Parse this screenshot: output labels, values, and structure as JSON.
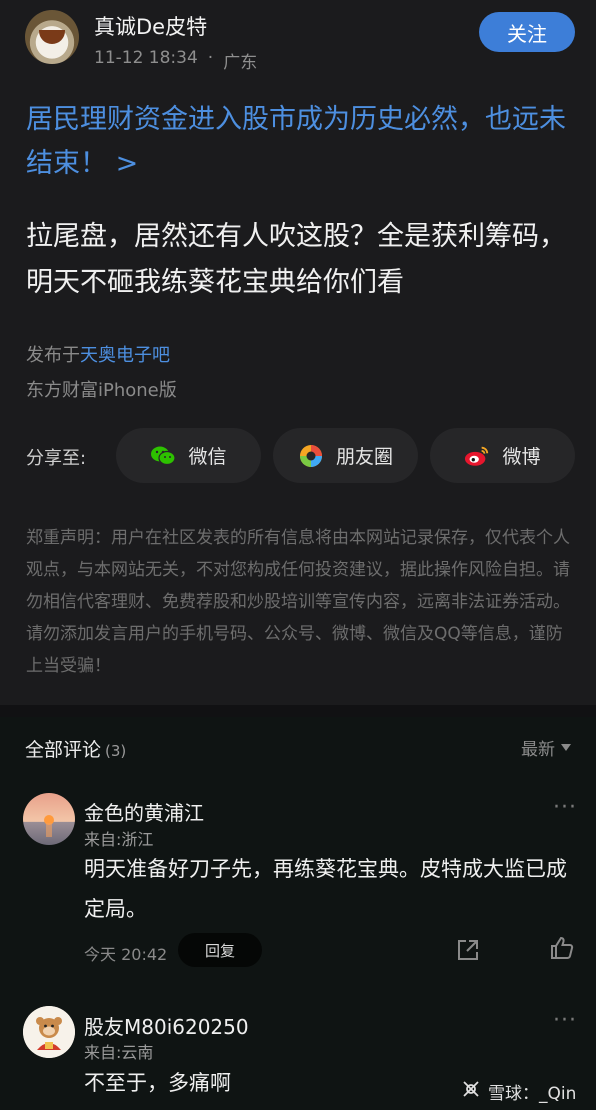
{
  "post": {
    "author": {
      "name": "真诚De皮特",
      "time": "11-12 18:34",
      "separator": "·",
      "location": "广东",
      "follow_label": "关注"
    },
    "topic_link": "居民理财资金进入股市成为历史必然，也远未结束！ >",
    "body": "拉尾盘，居然还有人吹这股？全是获利筹码，明天不砸我练葵花宝典给你们看",
    "published_prefix": "发布于",
    "published_bar": "天奥电子吧",
    "client": "东方财富iPhone版",
    "share": {
      "label": "分享至:",
      "buttons": [
        {
          "label": "微信",
          "icon": "wechat-icon",
          "color": "#2dc100"
        },
        {
          "label": "朋友圈",
          "icon": "moments-icon",
          "color": "#f5a623"
        },
        {
          "label": "微博",
          "icon": "weibo-icon",
          "color": "#e6162d"
        }
      ]
    },
    "disclaimer": "郑重声明：用户在社区发表的所有信息将由本网站记录保存，仅代表个人观点，与本网站无关，不对您构成任何投资建议，据此操作风险自担。请勿相信代客理财、免费荐股和炒股培训等宣传内容，远离非法证券活动。请勿添加发言用户的手机号码、公众号、微博、微信及QQ等信息，谨防上当受骗！"
  },
  "comments": {
    "title": "全部评论",
    "count": "(3)",
    "sort_label": "最新",
    "items": [
      {
        "name": "金色的黄浦江",
        "from": "来自:浙江",
        "text": "明天准备好刀子先，再练葵花宝典。皮特成大监已成定局。",
        "time": "今天 20:42",
        "reply_label": "回复",
        "more": "···"
      },
      {
        "name": "股友M80i620250",
        "from": "来自:云南",
        "text": "不至于，多痛啊",
        "more": "···"
      }
    ]
  },
  "watermark": "雪球：_Qin",
  "colors": {
    "accent": "#3d7ed8",
    "link": "#4d8fe0",
    "background": "#1b1b1d"
  }
}
